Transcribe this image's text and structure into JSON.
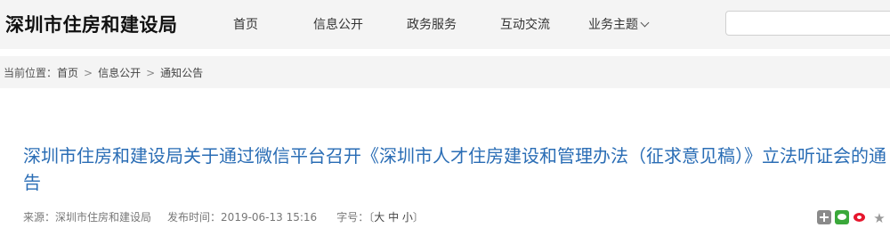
{
  "header": {
    "site_title": "深圳市住房和建设局",
    "nav": [
      {
        "label": "首页"
      },
      {
        "label": "信息公开"
      },
      {
        "label": "政务服务"
      },
      {
        "label": "互动交流"
      },
      {
        "label": "业务主题"
      }
    ],
    "search": {
      "value": "",
      "placeholder": ""
    }
  },
  "breadcrumb": {
    "prefix": "当前位置：",
    "items": [
      "首页",
      "信息公开",
      "通知公告"
    ],
    "separator": ">"
  },
  "article": {
    "title": "深圳市住房和建设局关于通过微信平台召开《深圳市人才住房建设和管理办法（征求意见稿）》立法听证会的通告",
    "source_label": "来源：",
    "source": "深圳市住房和建设局",
    "date_label": "发布时间：",
    "date": "2019-06-13 15:16",
    "fontsize_label": "字号：",
    "fontsize_open": "〔",
    "fontsize_large": "大",
    "fontsize_medium": "中",
    "fontsize_small": "小",
    "fontsize_close": "〕"
  },
  "share_icons": [
    "plus-icon",
    "wechat-icon",
    "weibo-icon",
    "star-icon"
  ]
}
